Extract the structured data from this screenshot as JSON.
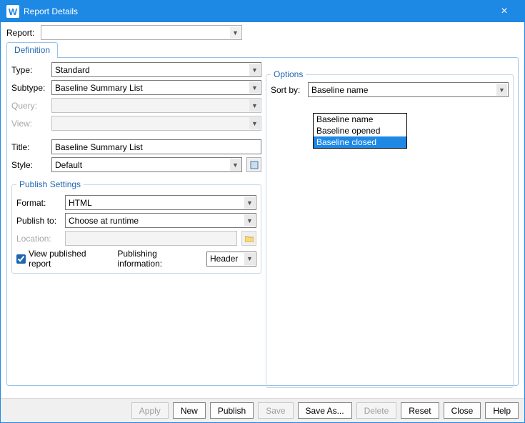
{
  "window": {
    "title": "Report Details",
    "icon_letter": "W"
  },
  "report_label": "Report:",
  "report_value": "",
  "tabs": [
    {
      "label": "Definition",
      "active": true
    }
  ],
  "fields": {
    "type": {
      "label": "Type:",
      "value": "Standard",
      "enabled": true
    },
    "subtype": {
      "label": "Subtype:",
      "value": "Baseline Summary List",
      "enabled": true
    },
    "query": {
      "label": "Query:",
      "value": "",
      "enabled": false
    },
    "view": {
      "label": "View:",
      "value": "",
      "enabled": false
    },
    "title": {
      "label": "Title:",
      "value": "Baseline Summary List",
      "enabled": true
    },
    "style": {
      "label": "Style:",
      "value": "Default",
      "enabled": true
    }
  },
  "publish": {
    "legend": "Publish Settings",
    "format": {
      "label": "Format:",
      "value": "HTML"
    },
    "publish_to": {
      "label": "Publish to:",
      "value": "Choose at runtime"
    },
    "location": {
      "label": "Location:",
      "value": "",
      "enabled": false
    },
    "view_check": {
      "label": "View published report",
      "checked": true
    },
    "pub_info": {
      "label": "Publishing information:",
      "value": "Header"
    }
  },
  "options": {
    "legend": "Options",
    "sort_by": {
      "label": "Sort by:",
      "value": "Baseline name"
    },
    "dropdown_open": true,
    "dropdown_items": [
      {
        "label": "Baseline name",
        "highlighted": false
      },
      {
        "label": "Baseline opened",
        "highlighted": false
      },
      {
        "label": "Baseline closed",
        "highlighted": true
      }
    ]
  },
  "buttons": {
    "apply": {
      "label": "Apply",
      "enabled": false
    },
    "new": {
      "label": "New",
      "enabled": true
    },
    "publish": {
      "label": "Publish",
      "enabled": true
    },
    "save": {
      "label": "Save",
      "enabled": false
    },
    "saveas": {
      "label": "Save As...",
      "enabled": true
    },
    "delete": {
      "label": "Delete",
      "enabled": false
    },
    "reset": {
      "label": "Reset",
      "enabled": true
    },
    "close": {
      "label": "Close",
      "enabled": true
    },
    "help": {
      "label": "Help",
      "enabled": true
    }
  }
}
